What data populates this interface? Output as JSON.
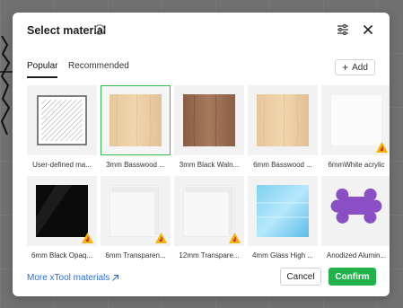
{
  "dialog": {
    "title": "Select material",
    "tabs": [
      {
        "label": "Popular",
        "active": true
      },
      {
        "label": "Recommended",
        "active": false
      }
    ],
    "add_label": "Add"
  },
  "materials": [
    {
      "label": "User-defined ma...",
      "swatch": "user-defined",
      "selected": false,
      "flammable": false
    },
    {
      "label": "3mm Basswood ...",
      "swatch": "basswood",
      "selected": true,
      "flammable": false
    },
    {
      "label": "3mm Black Waln...",
      "swatch": "walnut",
      "selected": false,
      "flammable": false
    },
    {
      "label": "6mm Basswood ...",
      "swatch": "basswood",
      "selected": false,
      "flammable": false
    },
    {
      "label": "6mmWhite acrylic",
      "swatch": "white-acrylic",
      "selected": false,
      "flammable": true
    },
    {
      "label": "6mm Black Opaq...",
      "swatch": "black-acrylic",
      "selected": false,
      "flammable": true
    },
    {
      "label": "6mm Transparen...",
      "swatch": "transparent",
      "selected": false,
      "flammable": true
    },
    {
      "label": "12mm Transpare...",
      "swatch": "transparent",
      "selected": false,
      "flammable": true
    },
    {
      "label": "4mm Glass High ...",
      "swatch": "glass",
      "selected": false,
      "flammable": false
    },
    {
      "label": "Anodized Alumin...",
      "swatch": "anodized-tag",
      "selected": false,
      "flammable": false
    }
  ],
  "footer": {
    "more_link": "More xTool materials",
    "cancel_label": "Cancel",
    "confirm_label": "Confirm"
  },
  "colors": {
    "accent_green": "#21b24b",
    "selected_border": "#2fbf4f",
    "link_blue": "#2a6fdb",
    "flame_badge": "#f5b400"
  }
}
